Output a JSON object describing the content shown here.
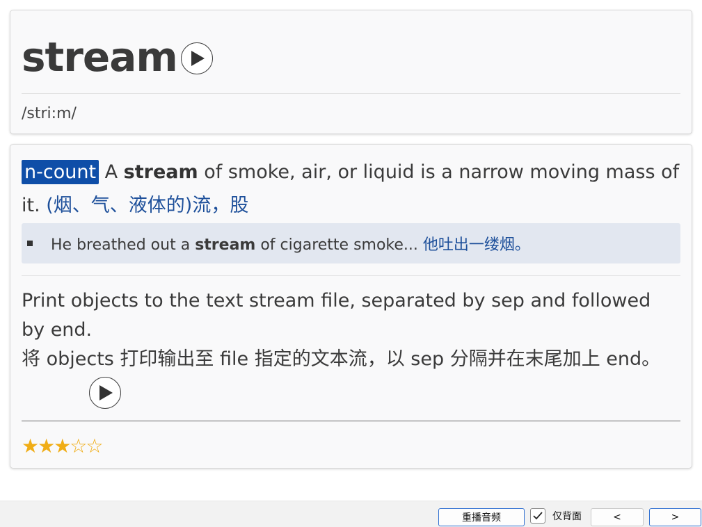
{
  "entry": {
    "word": "stream",
    "phonetic": "/stri:m/"
  },
  "definition": {
    "pos": "n-count",
    "text_pre": " A ",
    "text_bold": "stream",
    "text_post": " of smoke, air, or liquid is a narrow moving mass of it. ",
    "zh": "(烟、气、液体的)流，股"
  },
  "example": {
    "pre": "He breathed out a ",
    "bold": "stream",
    "post": " of cigarette smoke... ",
    "zh": "他吐出一缕烟。"
  },
  "note": {
    "en": "Print objects to the text stream file, separated by sep and followed by end.",
    "zh": "将 objects 打印输出至 file 指定的文本流，以 sep 分隔并在末尾加上 end。"
  },
  "rating": {
    "filled": 3,
    "total": 5,
    "display": "★★★☆☆"
  },
  "toolbar": {
    "replay_label": "重播音频",
    "back_only_label": "仅背面",
    "back_only_checked": true,
    "prev_label": "<",
    "next_label": ">"
  },
  "colors": {
    "pos_badge": "#0f4ea8",
    "zh_text": "#1d4f9a",
    "example_bg": "#e2e7f0",
    "stars": "#f0ad16",
    "focus_border": "#2f6fd1"
  },
  "icons": {
    "play": "play-icon",
    "check": "check-icon",
    "star": "star-icon"
  }
}
